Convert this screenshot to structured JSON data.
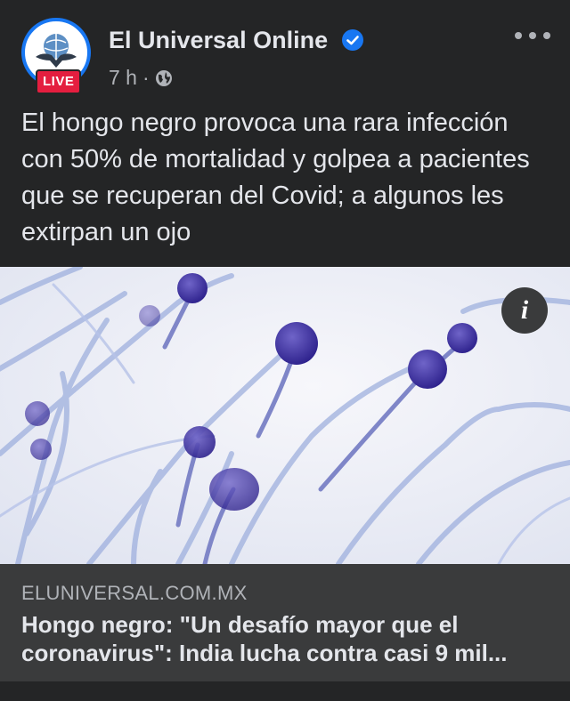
{
  "post": {
    "page_name": "El Universal Online",
    "live_badge": "LIVE",
    "time": "7 h",
    "dot": "·",
    "audience_icon": "globe-icon",
    "more_icon": "more-options-icon",
    "text": "El hongo negro provoca una rara infección con 50% de mortalidad y golpea a pacientes que se recuperan del Covid; a algunos les extirpan un ojo"
  },
  "link": {
    "info_icon": "i",
    "domain": "ELUNIVERSAL.COM.MX",
    "title_line1": "Hongo negro: \"Un desafío mayor que el",
    "title_line2": "coronavirus\": India lucha contra casi 9 mil..."
  },
  "colors": {
    "background": "#242526",
    "footer": "#3a3b3c",
    "verified": "#1877f2",
    "live": "#e41e3f"
  }
}
